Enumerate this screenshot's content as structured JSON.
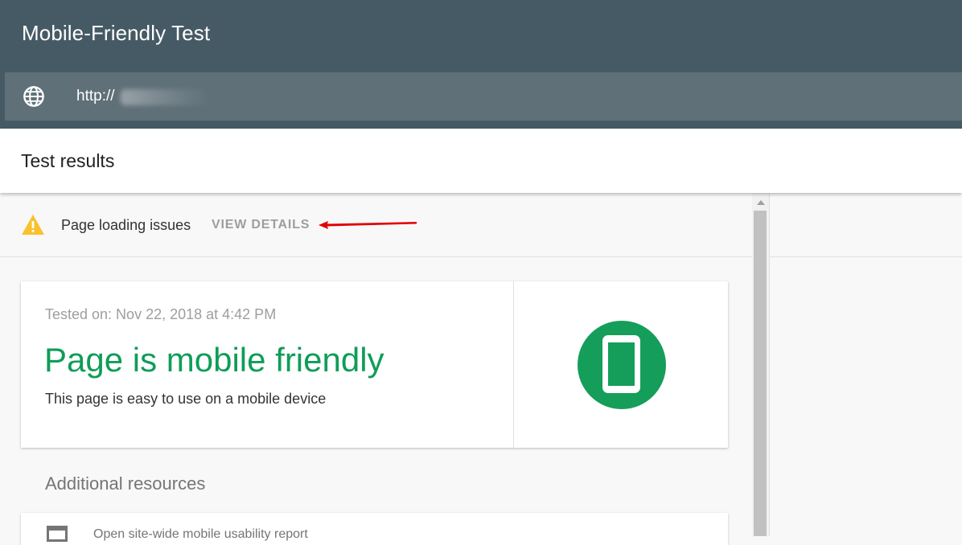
{
  "header": {
    "app_title": "Mobile-Friendly Test",
    "url_prefix": "http://",
    "globe_icon": "globe-icon"
  },
  "results": {
    "title": "Test results"
  },
  "issues": {
    "text": "Page loading issues",
    "view_details": "VIEW DETAILS",
    "icon": "warning-icon"
  },
  "result_card": {
    "tested_on": "Tested on: Nov 22, 2018 at 4:42 PM",
    "headline": "Page is mobile friendly",
    "subline": "This page is easy to use on a mobile device",
    "icon": "mobile-phone-icon",
    "accent_color": "#0f9d58"
  },
  "additional": {
    "title": "Additional resources",
    "items": [
      {
        "label": "Open site-wide mobile usability report",
        "icon": "web-report-icon"
      }
    ]
  },
  "colors": {
    "header_bg": "#455a64",
    "warning": "#fbc02d",
    "annotation_arrow": "#e00000"
  }
}
